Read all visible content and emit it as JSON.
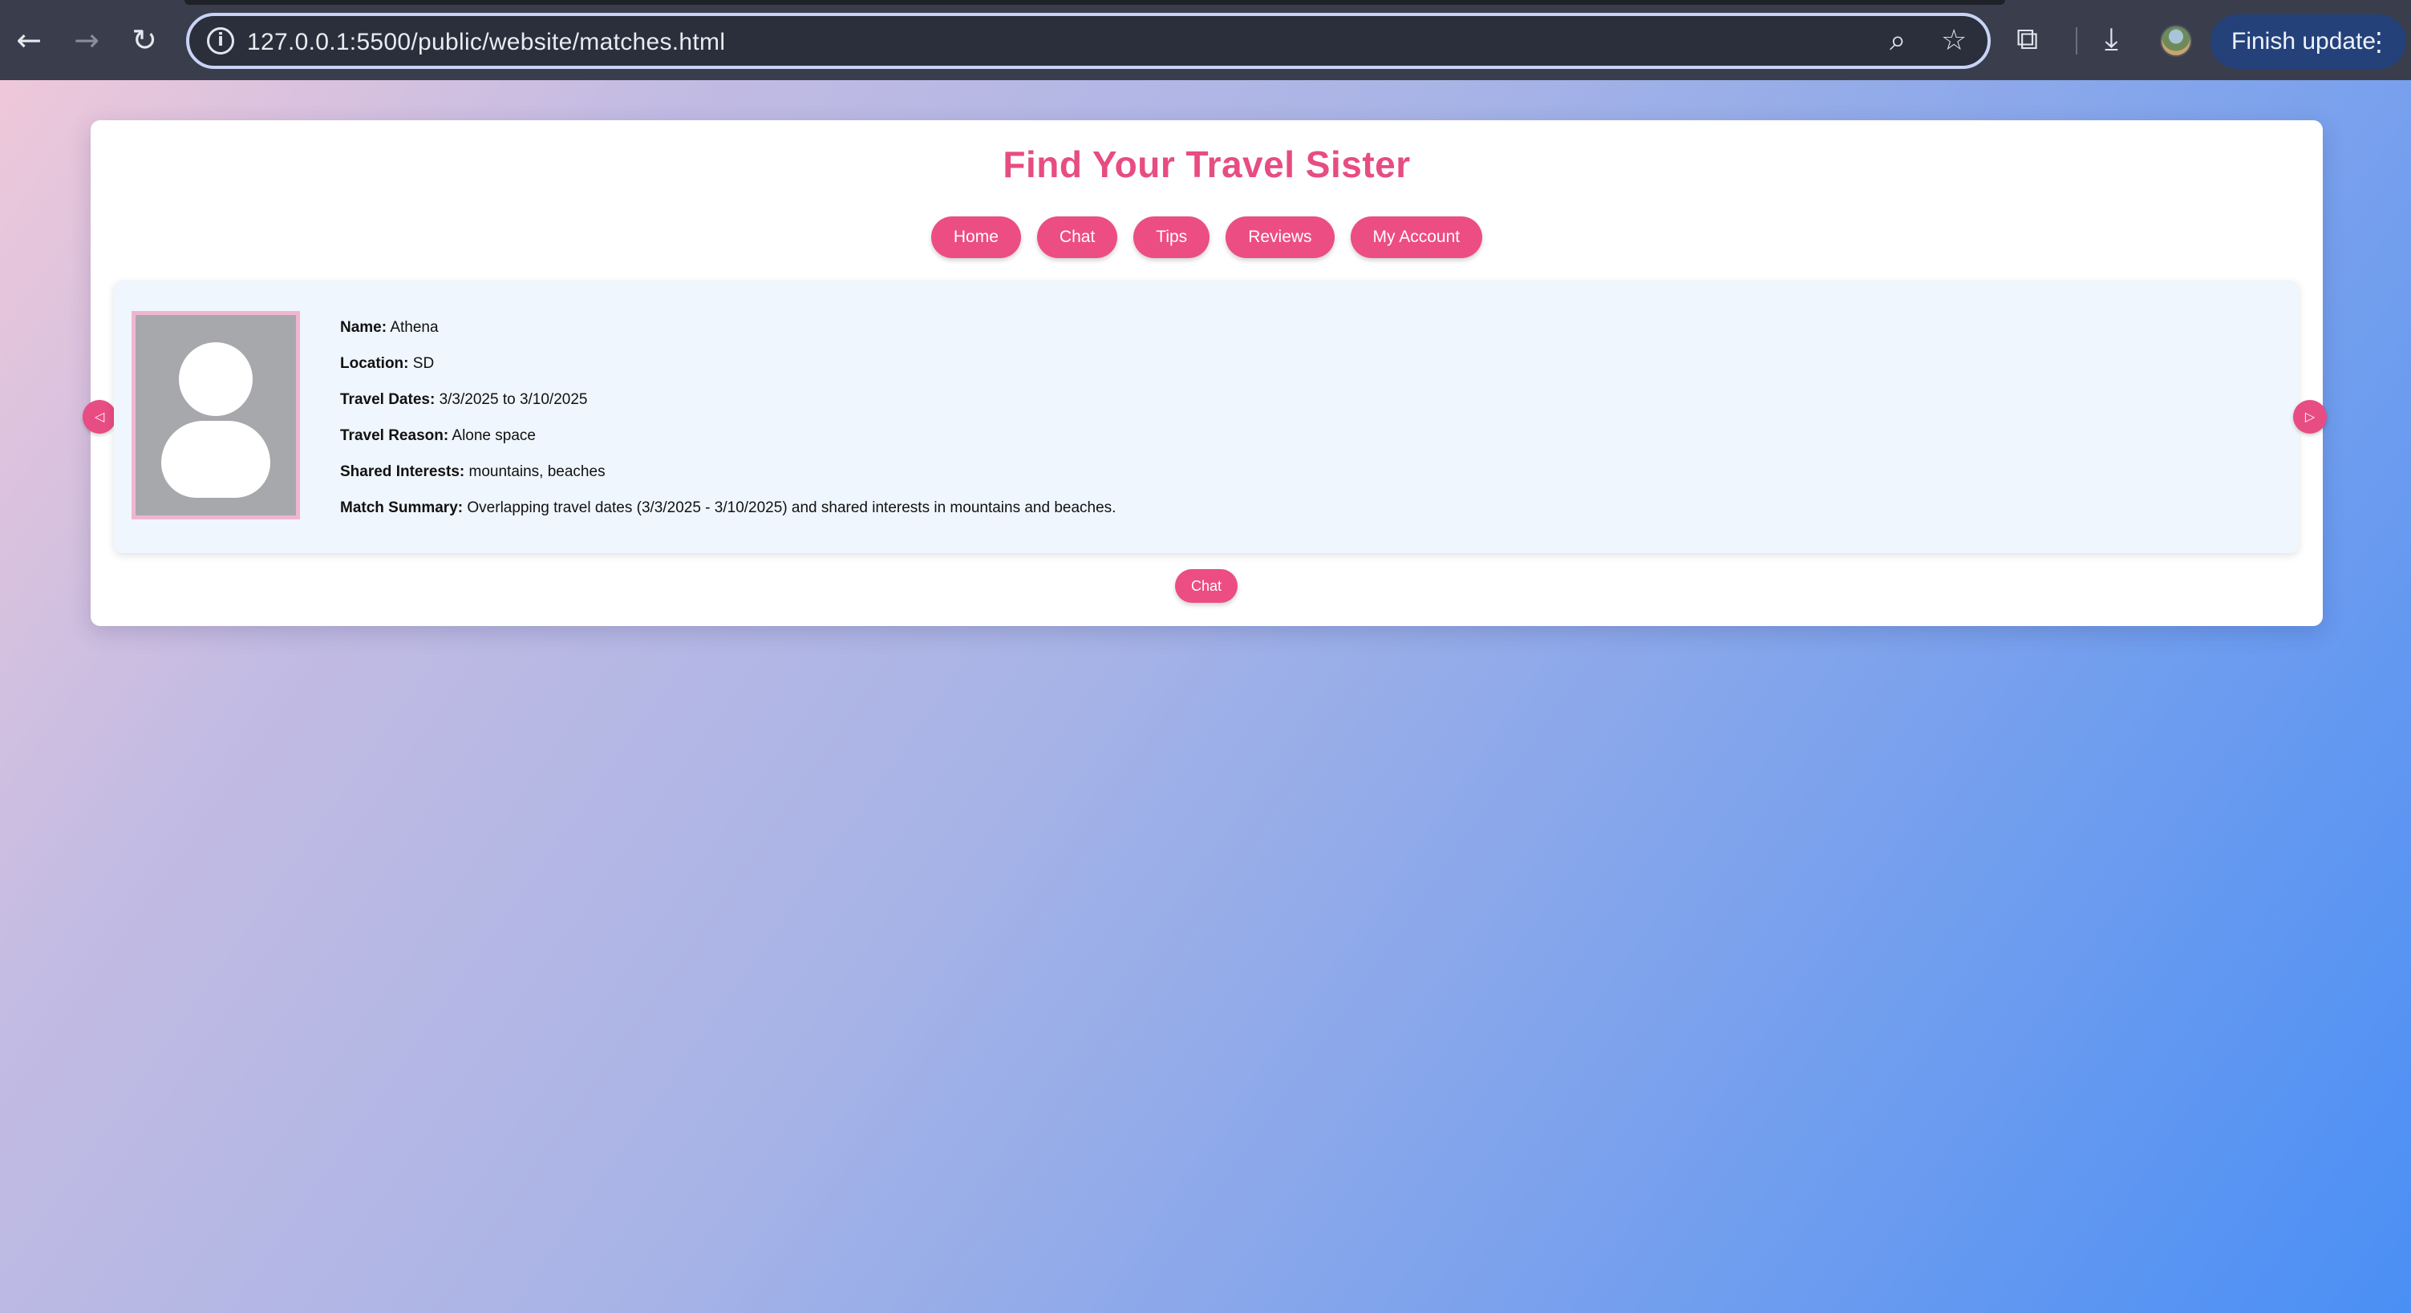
{
  "browser": {
    "url": "127.0.0.1:5500/public/website/matches.html",
    "update_label": "Finish update",
    "icons": {
      "back": "arrow-left-icon",
      "forward": "arrow-right-icon",
      "reload": "reload-icon",
      "info": "info-icon",
      "zoom": "zoom-icon",
      "bookmark": "star-icon",
      "extensions": "puzzle-icon",
      "downloads": "download-icon",
      "menu": "kebab-icon"
    }
  },
  "page": {
    "title": "Find Your Travel Sister",
    "accent_color": "#e74c82",
    "nav": [
      {
        "label": "Home"
      },
      {
        "label": "Chat"
      },
      {
        "label": "Tips"
      },
      {
        "label": "Reviews"
      },
      {
        "label": "My Account"
      }
    ],
    "match": {
      "fields": [
        {
          "label": "Name:",
          "value": "Athena"
        },
        {
          "label": "Location:",
          "value": "SD"
        },
        {
          "label": "Travel Dates:",
          "value": "3/3/2025 to 3/10/2025"
        },
        {
          "label": "Travel Reason:",
          "value": "Alone space"
        },
        {
          "label": "Shared Interests:",
          "value": "mountains, beaches"
        },
        {
          "label": "Match Summary:",
          "value": "Overlapping travel dates (3/3/2025 - 3/10/2025) and shared interests in mountains and beaches."
        }
      ]
    },
    "chat_button": "Chat"
  }
}
